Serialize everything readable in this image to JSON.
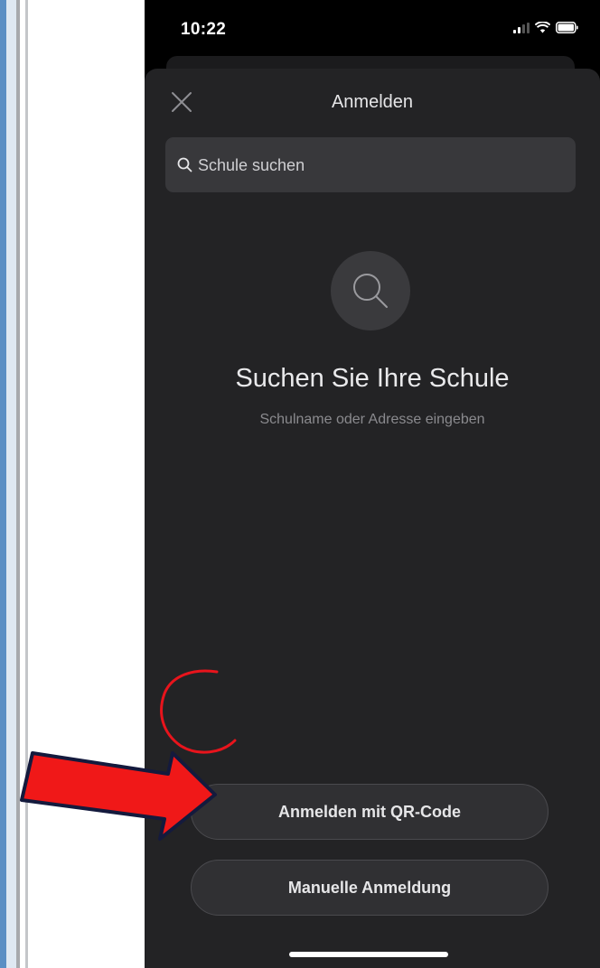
{
  "status_bar": {
    "time": "10:22"
  },
  "sheet": {
    "title": "Anmelden",
    "close_icon": "close-icon"
  },
  "search": {
    "placeholder": "Schule suchen",
    "icon": "search-icon"
  },
  "empty_state": {
    "icon": "search-icon",
    "heading": "Suchen Sie Ihre Schule",
    "subtitle": "Schulname oder Adresse eingeben"
  },
  "actions": {
    "qr_login": "Anmelden mit QR-Code",
    "manual_login": "Manuelle Anmeldung"
  },
  "colors": {
    "sheet_background": "#232325",
    "annotation_red": "#e8141c"
  }
}
